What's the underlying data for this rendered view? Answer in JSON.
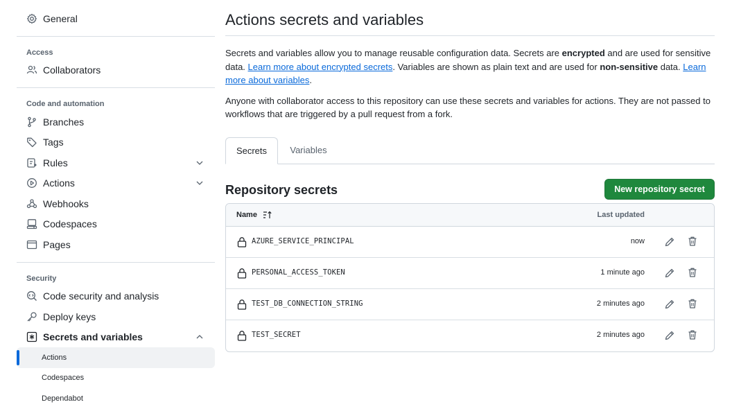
{
  "sidebar": {
    "general": "General",
    "access_heading": "Access",
    "collaborators": "Collaborators",
    "code_heading": "Code and automation",
    "branches": "Branches",
    "tags": "Tags",
    "rules": "Rules",
    "actions": "Actions",
    "webhooks": "Webhooks",
    "codespaces": "Codespaces",
    "pages": "Pages",
    "security_heading": "Security",
    "code_security": "Code security and analysis",
    "deploy_keys": "Deploy keys",
    "secrets_vars": "Secrets and variables",
    "sub_actions": "Actions",
    "sub_codespaces": "Codespaces",
    "sub_dependabot": "Dependabot"
  },
  "main": {
    "title": "Actions secrets and variables",
    "desc": {
      "p1_a": "Secrets and variables allow you to manage reusable configuration data. Secrets are ",
      "p1_b": "encrypted",
      "p1_c": " and are used for sensitive data. ",
      "link1": "Learn more about encrypted secrets",
      "p1_d": ". Variables are shown as plain text and are used for ",
      "p1_e": "non-sensitive",
      "p1_f": " data. ",
      "link2": "Learn more about variables",
      "p1_g": ".",
      "p2": "Anyone with collaborator access to this repository can use these secrets and variables for actions. They are not passed to workflows that are triggered by a pull request from a fork."
    },
    "tabs": [
      "Secrets",
      "Variables"
    ],
    "section_title": "Repository secrets",
    "new_button": "New repository secret",
    "table": {
      "col_name": "Name",
      "col_updated": "Last updated",
      "rows": [
        {
          "name": "AZURE_SERVICE_PRINCIPAL",
          "updated": "now"
        },
        {
          "name": "PERSONAL_ACCESS_TOKEN",
          "updated": "1 minute ago"
        },
        {
          "name": "TEST_DB_CONNECTION_STRING",
          "updated": "2 minutes ago"
        },
        {
          "name": "TEST_SECRET",
          "updated": "2 minutes ago"
        }
      ]
    }
  },
  "colors": {
    "accent": "#0969da",
    "primary_button": "#1f883d"
  }
}
